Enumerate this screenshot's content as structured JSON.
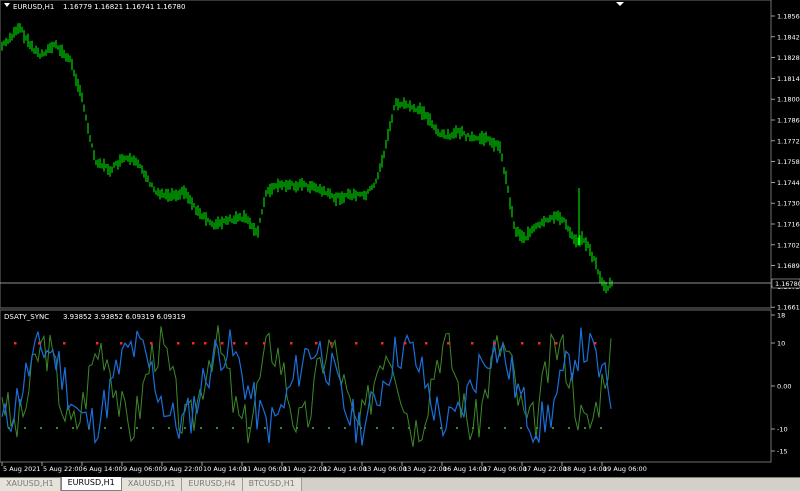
{
  "main_chart": {
    "title": "EURUSD,H1",
    "ohlc": "1.16779 1.16821 1.16741 1.16780",
    "price_ticks": [
      "1.18565",
      "1.18420",
      "1.18280",
      "1.18140",
      "1.18000",
      "1.17860",
      "1.17720",
      "1.17580",
      "1.17445",
      "1.17305",
      "1.17165",
      "1.17025",
      "1.16890",
      "1.16750",
      "1.16610"
    ],
    "current_price": "1.16780",
    "bar_color": "#00ff00",
    "price_line_color": "#c0c0c0"
  },
  "indicator": {
    "title": "DSATY_SYNC",
    "values": "3.93852 3.93852 6.09319 6.09319",
    "scale_ticks": [
      "18",
      "10",
      "0.00",
      "-10",
      "-15"
    ],
    "colors": {
      "blue": "#1a6fd8",
      "green": "#3c8a28",
      "red_dots": "#ff2020",
      "green_dots": "#2e8b2e"
    }
  },
  "time_axis": [
    "5 Aug 2021",
    "5 Aug 22:00",
    "6 Aug 14:00",
    "9 Aug 06:00",
    "9 Aug 22:00",
    "10 Aug 14:00",
    "11 Aug 06:00",
    "11 Aug 22:00",
    "12 Aug 14:00",
    "13 Aug 06:00",
    "13 Aug 22:00",
    "16 Aug 14:00",
    "17 Aug 06:00",
    "17 Aug 22:00",
    "18 Aug 14:00",
    "19 Aug 06:00"
  ],
  "tabs": [
    {
      "label": "XAUUSD,H1",
      "active": false
    },
    {
      "label": "EURUSD,H1",
      "active": true
    },
    {
      "label": "XAUUSD,H1",
      "active": false
    },
    {
      "label": "EURUSD,H4",
      "active": false
    },
    {
      "label": "BTCUSD,H1",
      "active": false
    }
  ]
}
